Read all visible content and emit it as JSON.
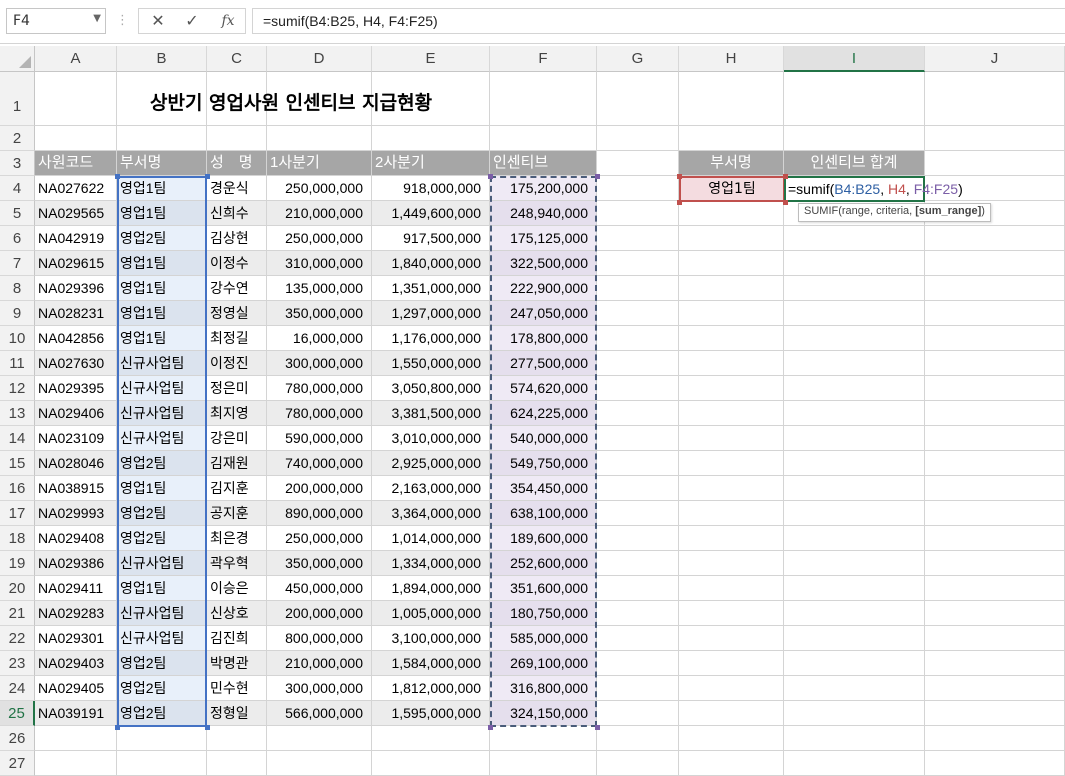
{
  "formula_bar": {
    "name_box": "F4",
    "formula": "=sumif(B4:B25, H4, F4:F25)",
    "cancel_icon": "✕",
    "enter_icon": "✓",
    "function_icon": "fx"
  },
  "columns": [
    "A",
    "B",
    "C",
    "D",
    "E",
    "F",
    "G",
    "H",
    "I",
    "J"
  ],
  "active_column": "I",
  "rows": [
    "1",
    "2",
    "3",
    "4",
    "5",
    "6",
    "7",
    "8",
    "9",
    "10",
    "11",
    "12",
    "13",
    "14",
    "15",
    "16",
    "17",
    "18",
    "19",
    "20",
    "21",
    "22",
    "23",
    "24",
    "25",
    "26",
    "27"
  ],
  "active_row": "25",
  "sheet": {
    "title": "상반기 영업사원 인센티브 지급현황",
    "headers": [
      "사원코드",
      "부서명",
      "성　명",
      "1사분기",
      "2사분기",
      "인센티브"
    ],
    "records": [
      [
        "NA027622",
        "영업1팀",
        "경운식",
        "250,000,000",
        "918,000,000",
        "175,200,000"
      ],
      [
        "NA029565",
        "영업1팀",
        "신희수",
        "210,000,000",
        "1,449,600,000",
        "248,940,000"
      ],
      [
        "NA042919",
        "영업2팀",
        "김상현",
        "250,000,000",
        "917,500,000",
        "175,125,000"
      ],
      [
        "NA029615",
        "영업1팀",
        "이정수",
        "310,000,000",
        "1,840,000,000",
        "322,500,000"
      ],
      [
        "NA029396",
        "영업1팀",
        "강수연",
        "135,000,000",
        "1,351,000,000",
        "222,900,000"
      ],
      [
        "NA028231",
        "영업1팀",
        "정영실",
        "350,000,000",
        "1,297,000,000",
        "247,050,000"
      ],
      [
        "NA042856",
        "영업1팀",
        "최정길",
        "16,000,000",
        "1,176,000,000",
        "178,800,000"
      ],
      [
        "NA027630",
        "신규사업팀",
        "이정진",
        "300,000,000",
        "1,550,000,000",
        "277,500,000"
      ],
      [
        "NA029395",
        "신규사업팀",
        "정은미",
        "780,000,000",
        "3,050,800,000",
        "574,620,000"
      ],
      [
        "NA029406",
        "신규사업팀",
        "최지영",
        "780,000,000",
        "3,381,500,000",
        "624,225,000"
      ],
      [
        "NA023109",
        "신규사업팀",
        "강은미",
        "590,000,000",
        "3,010,000,000",
        "540,000,000"
      ],
      [
        "NA028046",
        "영업2팀",
        "김재원",
        "740,000,000",
        "2,925,000,000",
        "549,750,000"
      ],
      [
        "NA038915",
        "영업1팀",
        "김지훈",
        "200,000,000",
        "2,163,000,000",
        "354,450,000"
      ],
      [
        "NA029993",
        "영업2팀",
        "공지훈",
        "890,000,000",
        "3,364,000,000",
        "638,100,000"
      ],
      [
        "NA029408",
        "영업2팀",
        "최은경",
        "250,000,000",
        "1,014,000,000",
        "189,600,000"
      ],
      [
        "NA029386",
        "신규사업팀",
        "곽우혁",
        "350,000,000",
        "1,334,000,000",
        "252,600,000"
      ],
      [
        "NA029411",
        "영업1팀",
        "이승은",
        "450,000,000",
        "1,894,000,000",
        "351,600,000"
      ],
      [
        "NA029283",
        "신규사업팀",
        "신상호",
        "200,000,000",
        "1,005,000,000",
        "180,750,000"
      ],
      [
        "NA029301",
        "신규사업팀",
        "김진희",
        "800,000,000",
        "3,100,000,000",
        "585,000,000"
      ],
      [
        "NA029403",
        "영업2팀",
        "박명관",
        "210,000,000",
        "1,584,000,000",
        "269,100,000"
      ],
      [
        "NA029405",
        "영업2팀",
        "민수현",
        "300,000,000",
        "1,812,000,000",
        "316,800,000"
      ],
      [
        "NA039191",
        "영업2팀",
        "정형일",
        "566,000,000",
        "1,595,000,000",
        "324,150,000"
      ]
    ]
  },
  "summary": {
    "header_dept": "부서명",
    "header_total": "인센티브 합계",
    "dept_value": "영업1팀",
    "editing_formula_parts": [
      "=sumif(",
      "B4:B25",
      ", ",
      "H4",
      ", ",
      "F4:F25",
      ")"
    ],
    "formula_part_colors": [
      "#000000",
      "#2e5fa3",
      "#000000",
      "#c0504d",
      "#000000",
      "#7b5ea7",
      "#000000"
    ],
    "tooltip_text": "SUMIF(range, criteria, ",
    "tooltip_bold": "[sum_range]",
    "tooltip_close": ")"
  }
}
